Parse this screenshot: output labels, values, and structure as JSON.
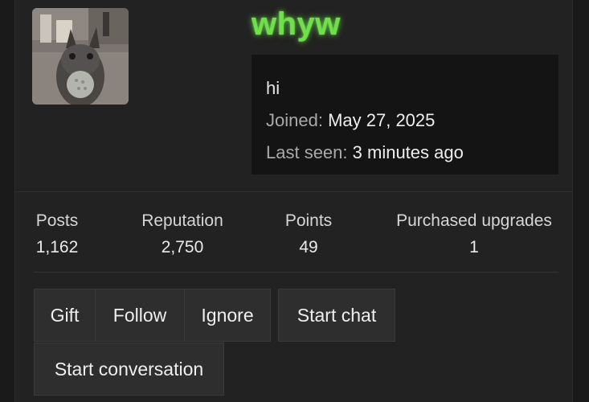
{
  "profile": {
    "username": "whyw",
    "status_text": "hi",
    "joined_label": "Joined:",
    "joined_value": "May 27, 2025",
    "last_seen_label": "Last seen:",
    "last_seen_value": "3 minutes ago",
    "username_color": "#6fe04a"
  },
  "stats": [
    {
      "label": "Posts",
      "value": "1,162"
    },
    {
      "label": "Reputation",
      "value": "2,750"
    },
    {
      "label": "Points",
      "value": "49"
    },
    {
      "label": "Purchased upgrades",
      "value": "1"
    }
  ],
  "actions": {
    "gift": "Gift",
    "follow": "Follow",
    "ignore": "Ignore",
    "start_chat": "Start chat",
    "start_conversation": "Start conversation"
  }
}
